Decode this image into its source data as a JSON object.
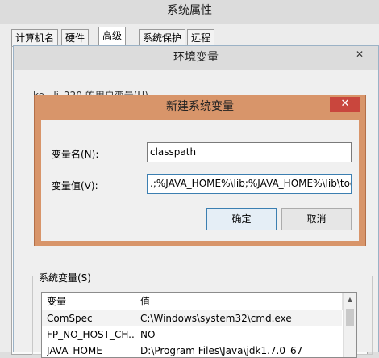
{
  "system_properties": {
    "title": "系统属性",
    "tabs": [
      "计算机名",
      "硬件",
      "高级",
      "系统保护",
      "远程"
    ]
  },
  "env_window": {
    "title": "环境变量",
    "close": "✕",
    "user_vars_label": "ke...li_220 的用户变量(U)",
    "system_vars_label": "系统变量(S)",
    "table": {
      "headers": [
        "变量",
        "值"
      ],
      "rows": [
        [
          "ComSpec",
          "C:\\Windows\\system32\\cmd.exe"
        ],
        [
          "FP_NO_HOST_CH...",
          "NO"
        ],
        [
          "JAVA_HOME",
          "D:\\Program Files\\Java\\jdk1.7.0_67"
        ]
      ]
    },
    "scroll_up": "▲"
  },
  "new_var_dialog": {
    "title": "新建系统变量",
    "close": "✕",
    "name_label": "变量名(N):",
    "name_value": "classpath",
    "value_label": "变量值(V):",
    "value_value": ".;%JAVA_HOME%\\lib;%JAVA_HOME%\\lib\\tools.jar",
    "ok": "确定",
    "cancel": "取消"
  },
  "colors": {
    "dialog_accent": "#d8956a",
    "close_red": "#c9463d",
    "focus_blue": "#3c7fb1"
  }
}
